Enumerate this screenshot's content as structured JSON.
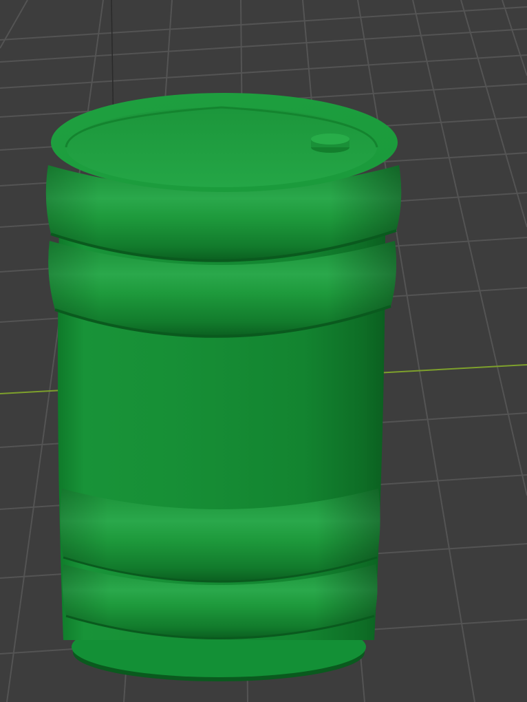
{
  "scene": {
    "object": "barrel",
    "object_color": "#1e9a3c",
    "viewport_background": "#3d3d3d",
    "grid_line_color": "#545454",
    "x_axis_color": "#7ea12c"
  },
  "icons": {
    "barrel": "barrel-mesh",
    "bung": "bung-cap",
    "grid": "floor-grid"
  }
}
